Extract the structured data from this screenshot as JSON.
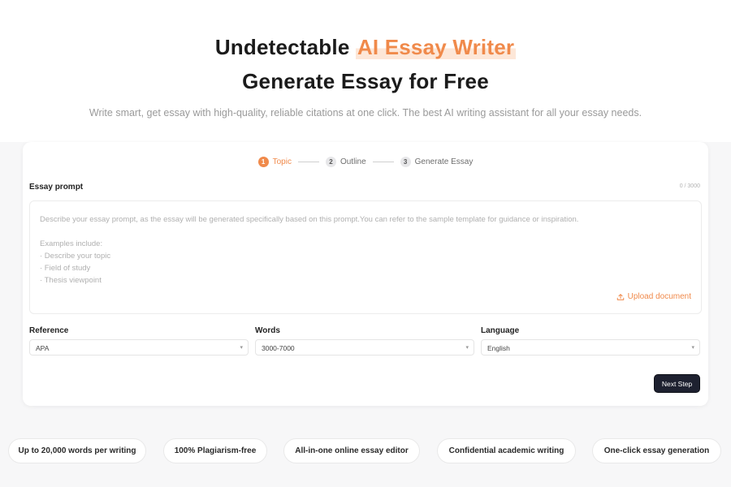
{
  "hero": {
    "title_prefix": "Undetectable ",
    "title_accent": "AI Essay Writer",
    "title_line2": "Generate Essay for Free",
    "subtitle": "Write smart, get essay with high-quality, reliable citations at one click. The best AI writing assistant for all your essay needs."
  },
  "stepper": {
    "steps": [
      {
        "num": "1",
        "label": "Topic",
        "active": true
      },
      {
        "num": "2",
        "label": "Outline",
        "active": false
      },
      {
        "num": "3",
        "label": "Generate Essay",
        "active": false
      }
    ]
  },
  "prompt": {
    "label": "Essay prompt",
    "counter": "0 / 3000",
    "placeholder": "Describe your essay prompt, as the essay will be generated specifically based on this prompt.You can refer to the sample template for guidance or inspiration.\n\nExamples include:\n· Describe your topic\n· Field of study\n· Thesis viewpoint",
    "upload_label": "Upload document",
    "upload_icon": "upload-icon"
  },
  "fields": {
    "reference": {
      "label": "Reference",
      "value": "APA"
    },
    "words": {
      "label": "Words",
      "value": "3000-7000"
    },
    "language": {
      "label": "Language",
      "value": "English"
    }
  },
  "actions": {
    "next_label": "Next Step"
  },
  "features": [
    "Up to 20,000 words per writing",
    "100% Plagiarism-free",
    "All-in-one online essay editor",
    "Confidential academic writing",
    "One-click essay generation"
  ],
  "colors": {
    "accent": "#f08a4b",
    "button_dark": "#1e2130"
  }
}
